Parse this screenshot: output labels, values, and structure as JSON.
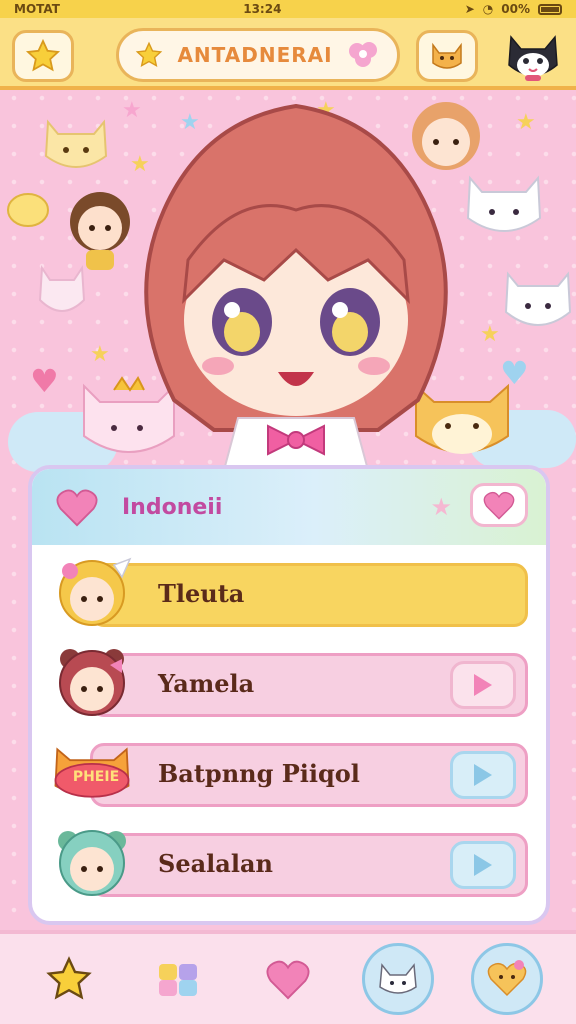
{
  "status_bar": {
    "carrier": "MOTAT",
    "time": "13:24",
    "battery": "00%"
  },
  "top_bar": {
    "title": "ANTADNERAI"
  },
  "panel": {
    "title": "Indoneii"
  },
  "list": [
    {
      "label": "Tleuta",
      "selected": true
    },
    {
      "label": "Yamela",
      "selected": false
    },
    {
      "label": "Batpnng Piiqol",
      "badge": "PHEIE",
      "selected": false
    },
    {
      "label": "Sealalan",
      "selected": false
    }
  ],
  "colors": {
    "accent_yellow": "#f8d560",
    "accent_pink": "#f7cfe1",
    "accent_blue": "#cfe8f6"
  }
}
